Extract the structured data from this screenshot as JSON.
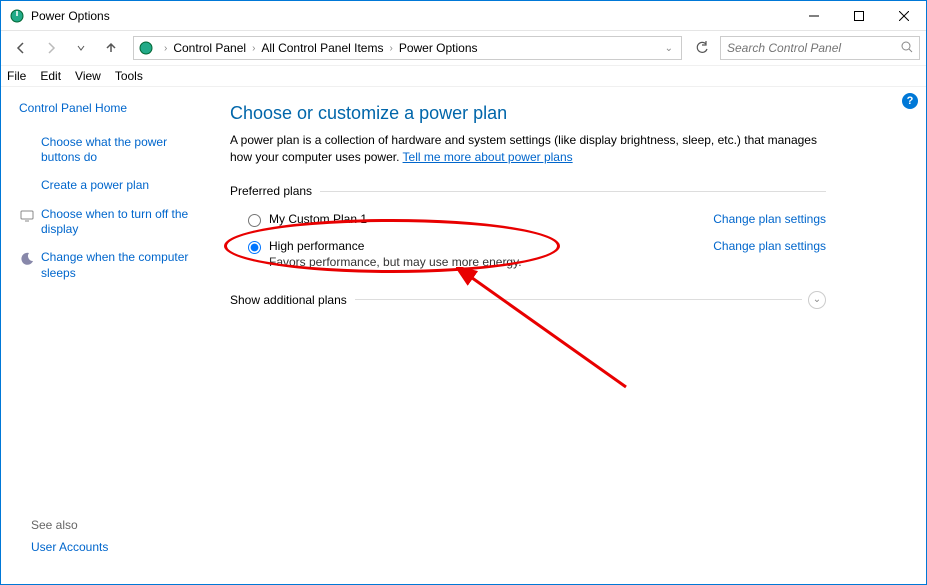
{
  "window": {
    "title": "Power Options"
  },
  "breadcrumb": {
    "items": [
      "Control Panel",
      "All Control Panel Items",
      "Power Options"
    ]
  },
  "search": {
    "placeholder": "Search Control Panel"
  },
  "menubar": {
    "items": [
      "File",
      "Edit",
      "View",
      "Tools"
    ]
  },
  "sidebar": {
    "home": "Control Panel Home",
    "links": [
      "Choose what the power buttons do",
      "Create a power plan",
      "Choose when to turn off the display",
      "Change when the computer sleeps"
    ],
    "see_also_label": "See also",
    "see_also_links": [
      "User Accounts"
    ]
  },
  "main": {
    "heading": "Choose or customize a power plan",
    "description_pre": "A power plan is a collection of hardware and system settings (like display brightness, sleep, etc.) that manages how your computer uses power. ",
    "description_link": "Tell me more about power plans",
    "preferred_label": "Preferred plans",
    "plans": [
      {
        "name": "My Custom Plan 1",
        "desc": "",
        "selected": false,
        "settings_link": "Change plan settings"
      },
      {
        "name": "High performance",
        "desc": "Favors performance, but may use more energy.",
        "selected": true,
        "settings_link": "Change plan settings"
      }
    ],
    "show_additional": "Show additional plans"
  }
}
